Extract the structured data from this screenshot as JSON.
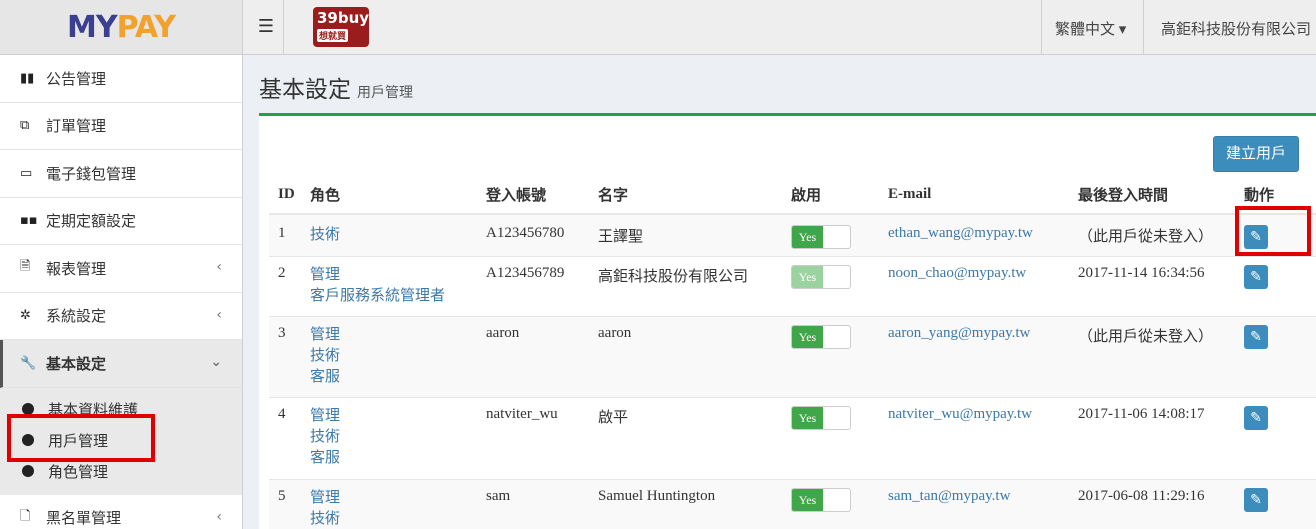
{
  "logo": {
    "part1": "MY",
    "part2": "PAY"
  },
  "header": {
    "menu_icon": "hamburger-icon",
    "brand_badge_top": "39buy",
    "brand_badge_bottom": "想就買",
    "language": "繁體中文 ▾",
    "company": "高鉅科技股份有限公司"
  },
  "sidebar": {
    "items": [
      {
        "label": "公告管理",
        "icon": "map-icon"
      },
      {
        "label": "訂單管理",
        "icon": "orders-icon"
      },
      {
        "label": "電子錢包管理",
        "icon": "credit-card-icon"
      },
      {
        "label": "定期定額設定",
        "icon": "grid-icon"
      },
      {
        "label": "報表管理",
        "icon": "file-icon",
        "chevron": "‹"
      },
      {
        "label": "系統設定",
        "icon": "gear-icon",
        "chevron": "‹"
      },
      {
        "label": "基本設定",
        "icon": "wrench-icon",
        "chevron": "⌄",
        "active": true
      }
    ],
    "sub_items": [
      "基本資料維護",
      "用戶管理",
      "角色管理"
    ],
    "bottom_item": {
      "label": "黑名單管理",
      "icon": "file-icon",
      "chevron": "‹"
    }
  },
  "page": {
    "title": "基本設定",
    "subtitle": "用戶管理",
    "create_button": "建立用戶"
  },
  "table": {
    "headers": [
      "ID",
      "角色",
      "登入帳號",
      "名字",
      "啟用",
      "E-mail",
      "最後登入時間",
      "動作"
    ],
    "rows": [
      {
        "id": "1",
        "roles": [
          "技術"
        ],
        "account": "A123456780",
        "name": "王譯聖",
        "enabled": "Yes",
        "email": "ethan_wang@mypay.tw",
        "last_login": "（此用戶從未登入）"
      },
      {
        "id": "2",
        "roles": [
          "管理",
          "客戶服務系統管理者"
        ],
        "account": "A123456789",
        "name": "高鉅科技股份有限公司",
        "enabled": "Yes",
        "email": "noon_chao@mypay.tw",
        "last_login": "2017-11-14 16:34:56"
      },
      {
        "id": "3",
        "roles": [
          "管理",
          "技術",
          "客服"
        ],
        "account": "aaron",
        "name": "aaron",
        "enabled": "Yes",
        "email": "aaron_yang@mypay.tw",
        "last_login": "（此用戶從未登入）"
      },
      {
        "id": "4",
        "roles": [
          "管理",
          "技術",
          "客服"
        ],
        "account": "natviter_wu",
        "name": "啟平",
        "enabled": "Yes",
        "email": "natviter_wu@mypay.tw",
        "last_login": "2017-11-06 14:08:17"
      },
      {
        "id": "5",
        "roles": [
          "管理",
          "技術"
        ],
        "account": "sam",
        "name": "Samuel Huntington",
        "enabled": "Yes",
        "email": "sam_tan@mypay.tw",
        "last_login": "2017-06-08 11:29:16"
      }
    ]
  },
  "colors": {
    "accent": "#3c8dbc",
    "highlight": "#e00000",
    "toggle_on": "#3fa64a",
    "panel_top": "#20a050"
  }
}
